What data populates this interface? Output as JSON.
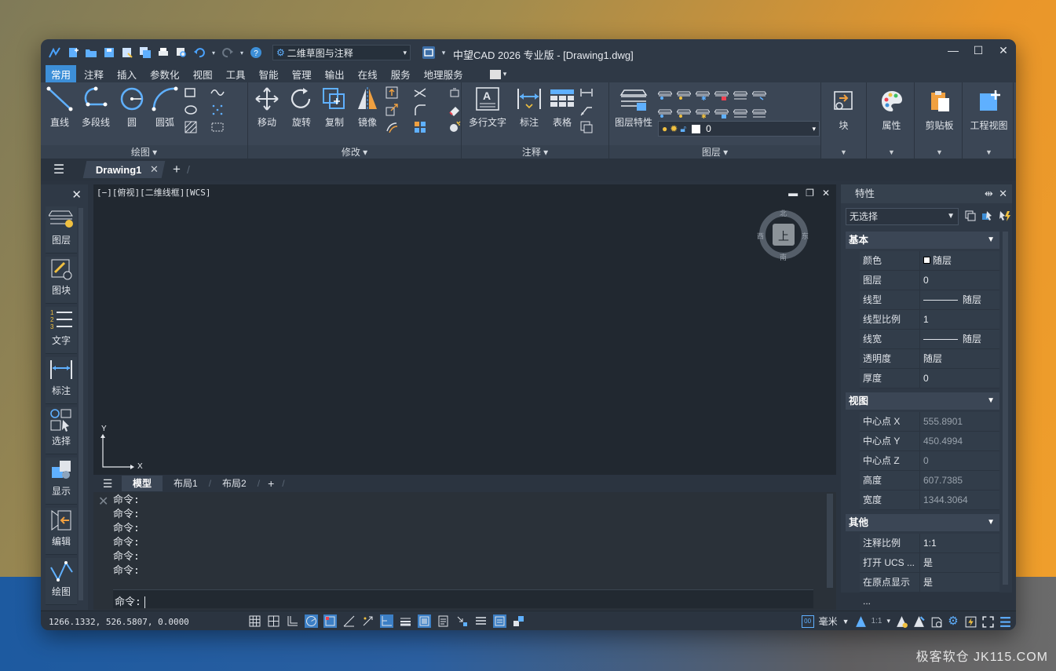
{
  "watermark": "极客软仓 JK115.COM",
  "window": {
    "title": "中望CAD 2026 专业版 - [Drawing1.dwg]",
    "workspace": "二维草图与注释"
  },
  "menu": [
    "常用",
    "注释",
    "插入",
    "参数化",
    "视图",
    "工具",
    "智能",
    "管理",
    "输出",
    "在线",
    "服务",
    "地理服务"
  ],
  "ribbon": {
    "draw": {
      "title": "绘图",
      "buttons": [
        "直线",
        "多段线",
        "圆",
        "圆弧"
      ]
    },
    "modify": {
      "title": "修改",
      "buttons": [
        "移动",
        "旋转",
        "复制",
        "镜像"
      ]
    },
    "annotate": {
      "title": "注释",
      "buttons": [
        "多行文字",
        "标注",
        "表格"
      ]
    },
    "layers": {
      "title": "图层",
      "button": "图层特性",
      "current_layer": "0"
    },
    "block": "块",
    "properties": "属性",
    "clipboard": "剪贴板",
    "projview": "工程视图"
  },
  "doc_tab": "Drawing1",
  "left_palette": [
    "图层",
    "图块",
    "文字",
    "标注",
    "选择",
    "显示",
    "编辑",
    "绘图"
  ],
  "viewport": {
    "label": "[−][俯视][二维线框][WCS]",
    "viewcube": {
      "top": "上",
      "north": "北",
      "south": "南",
      "east": "东",
      "west": "西"
    },
    "ucs_x": "X",
    "ucs_y": "Y"
  },
  "layout_tabs": [
    "模型",
    "布局1",
    "布局2"
  ],
  "command": {
    "history": [
      "命令:",
      "命令:",
      "命令:",
      "命令:",
      "命令:",
      "命令:"
    ],
    "prompt": "命令:"
  },
  "properties": {
    "title": "特性",
    "selection": "无选择",
    "sections": {
      "basic": {
        "title": "基本",
        "rows": [
          {
            "k": "颜色",
            "v": "随层"
          },
          {
            "k": "图层",
            "v": "0"
          },
          {
            "k": "线型",
            "v": "随层"
          },
          {
            "k": "线型比例",
            "v": "1"
          },
          {
            "k": "线宽",
            "v": "随层"
          },
          {
            "k": "透明度",
            "v": "随层"
          },
          {
            "k": "厚度",
            "v": "0"
          }
        ]
      },
      "view": {
        "title": "视图",
        "rows": [
          {
            "k": "中心点 X",
            "v": "555.8901"
          },
          {
            "k": "中心点 Y",
            "v": "450.4994"
          },
          {
            "k": "中心点 Z",
            "v": "0"
          },
          {
            "k": "高度",
            "v": "607.7385"
          },
          {
            "k": "宽度",
            "v": "1344.3064"
          }
        ]
      },
      "misc": {
        "title": "其他",
        "rows": [
          {
            "k": "注释比例",
            "v": "1:1"
          },
          {
            "k": "打开 UCS ...",
            "v": "是"
          },
          {
            "k": "在原点显示 ...",
            "v": "是"
          }
        ]
      }
    }
  },
  "status": {
    "coords": "1266.1332, 526.5807, 0.0000",
    "units": "毫米",
    "scale": "1:1"
  }
}
